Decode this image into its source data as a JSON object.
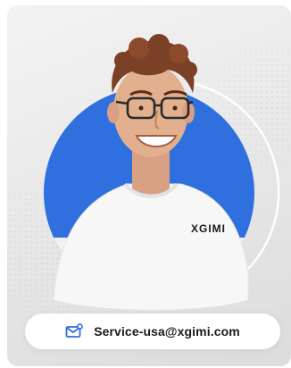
{
  "card": {
    "shirt_logo": "XGIMI",
    "accent_color": "#2f6fde"
  },
  "contact": {
    "email": "Service-usa@xgimi.com",
    "icon": "mail-icon"
  }
}
